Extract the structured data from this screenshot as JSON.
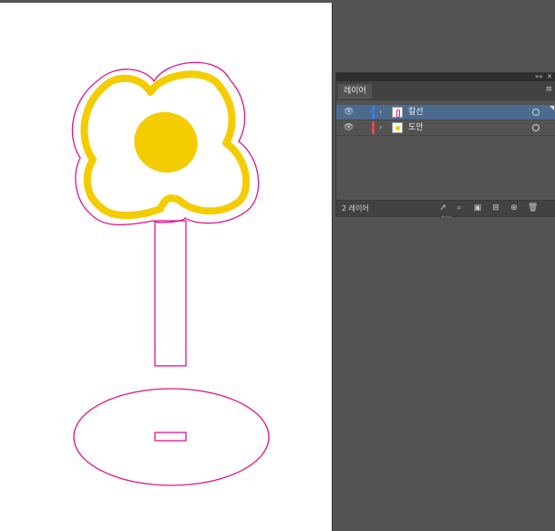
{
  "panel": {
    "tab_label": "레이어",
    "collapse_label": "««",
    "close_label": "✕",
    "menu_label": "≡",
    "footer_count": "2 레이어",
    "layers": [
      {
        "name": "칼선",
        "color": "#3f7bd9",
        "selected": true
      },
      {
        "name": "도안",
        "color": "#e24a4a",
        "selected": false
      }
    ]
  },
  "icons": {
    "eye": "eye-icon",
    "chevron": "chevron-right-icon",
    "target": "target-circle-icon",
    "export": "export-icon",
    "locate": "locate-object-icon",
    "clip": "make-clipping-mask-icon",
    "sublayer": "new-sublayer-icon",
    "newlayer": "new-layer-icon",
    "trash": "trash-icon"
  },
  "colors": {
    "cutline": "#e0148c",
    "flower": "#f3cd02",
    "selection": "#4b6b8f"
  }
}
